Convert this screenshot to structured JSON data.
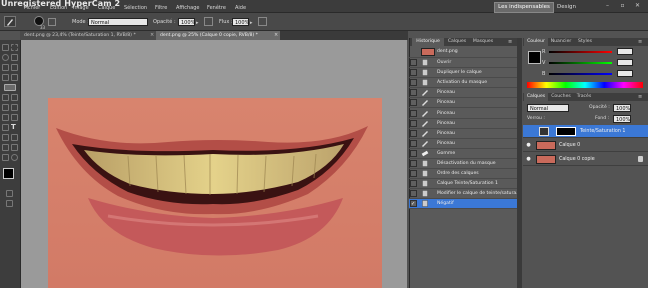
{
  "watermark": "Unregistered HyperCam 2",
  "menu": [
    "Fichier",
    "Édition",
    "Image",
    "Calque",
    "Sélection",
    "Filtre",
    "Affichage",
    "Fenêtre",
    "Aide"
  ],
  "workspace": {
    "active": "Les indispensables",
    "other": "Design"
  },
  "options": {
    "mode_label": "Mode :",
    "mode_value": "Normal",
    "opacity_label": "Opacité :",
    "opacity_value": "100%",
    "flux_label": "Flux :",
    "flux_value": "100%"
  },
  "tabs": [
    {
      "label": "dent.png @ 23,4% (Teinte/Saturation 1, RVB/8) *",
      "active": false
    },
    {
      "label": "dent.png @ 25% (Calque 0 copie, RVB/8) *",
      "active": true
    }
  ],
  "history": {
    "tabs": [
      "Historique",
      "Calques",
      "Masques"
    ],
    "snapshot": "dent.png",
    "items": [
      {
        "label": "Ouvrir",
        "icon": "document-icon"
      },
      {
        "label": "Dupliquer le calque",
        "icon": "document-icon"
      },
      {
        "label": "Activation du masque",
        "icon": "document-icon"
      },
      {
        "label": "Pinceau",
        "icon": "brush-icon"
      },
      {
        "label": "Pinceau",
        "icon": "brush-icon"
      },
      {
        "label": "Pinceau",
        "icon": "brush-icon"
      },
      {
        "label": "Pinceau",
        "icon": "brush-icon"
      },
      {
        "label": "Pinceau",
        "icon": "brush-icon"
      },
      {
        "label": "Pinceau",
        "icon": "brush-icon"
      },
      {
        "label": "Gomme",
        "icon": "eraser-icon"
      },
      {
        "label": "Désactivation du masque",
        "icon": "document-icon"
      },
      {
        "label": "Ordre des calques",
        "icon": "document-icon"
      },
      {
        "label": "Calque Teinte/Saturation 1",
        "icon": "document-icon"
      },
      {
        "label": "Modifier le calque de teinte/satura...",
        "icon": "document-icon"
      },
      {
        "label": "Négatif",
        "icon": "document-icon",
        "selected": true
      }
    ]
  },
  "color_panel": {
    "tabs": [
      "Couleur",
      "Nuancier",
      "Styles"
    ],
    "channels": [
      "R",
      "V",
      "B"
    ]
  },
  "layers_panel": {
    "tabs": [
      "Calques",
      "Couches",
      "Tracés"
    ],
    "blend_mode": "Normal",
    "opacity_label": "Opacité :",
    "opacity_value": "100%",
    "lock_label": "Verrou :",
    "fill_label": "Fond :",
    "fill_value": "100%",
    "layers": [
      {
        "name": "Teinte/Saturation 1",
        "selected": true,
        "visible": false
      },
      {
        "name": "Calque 0",
        "selected": false,
        "visible": true
      },
      {
        "name": "Calque 0 copie",
        "selected": false,
        "visible": true,
        "locked": true
      }
    ]
  },
  "colors": {
    "accent": "#3b78d6",
    "chrome": "#535353",
    "canvas": "#9a9a9a"
  }
}
